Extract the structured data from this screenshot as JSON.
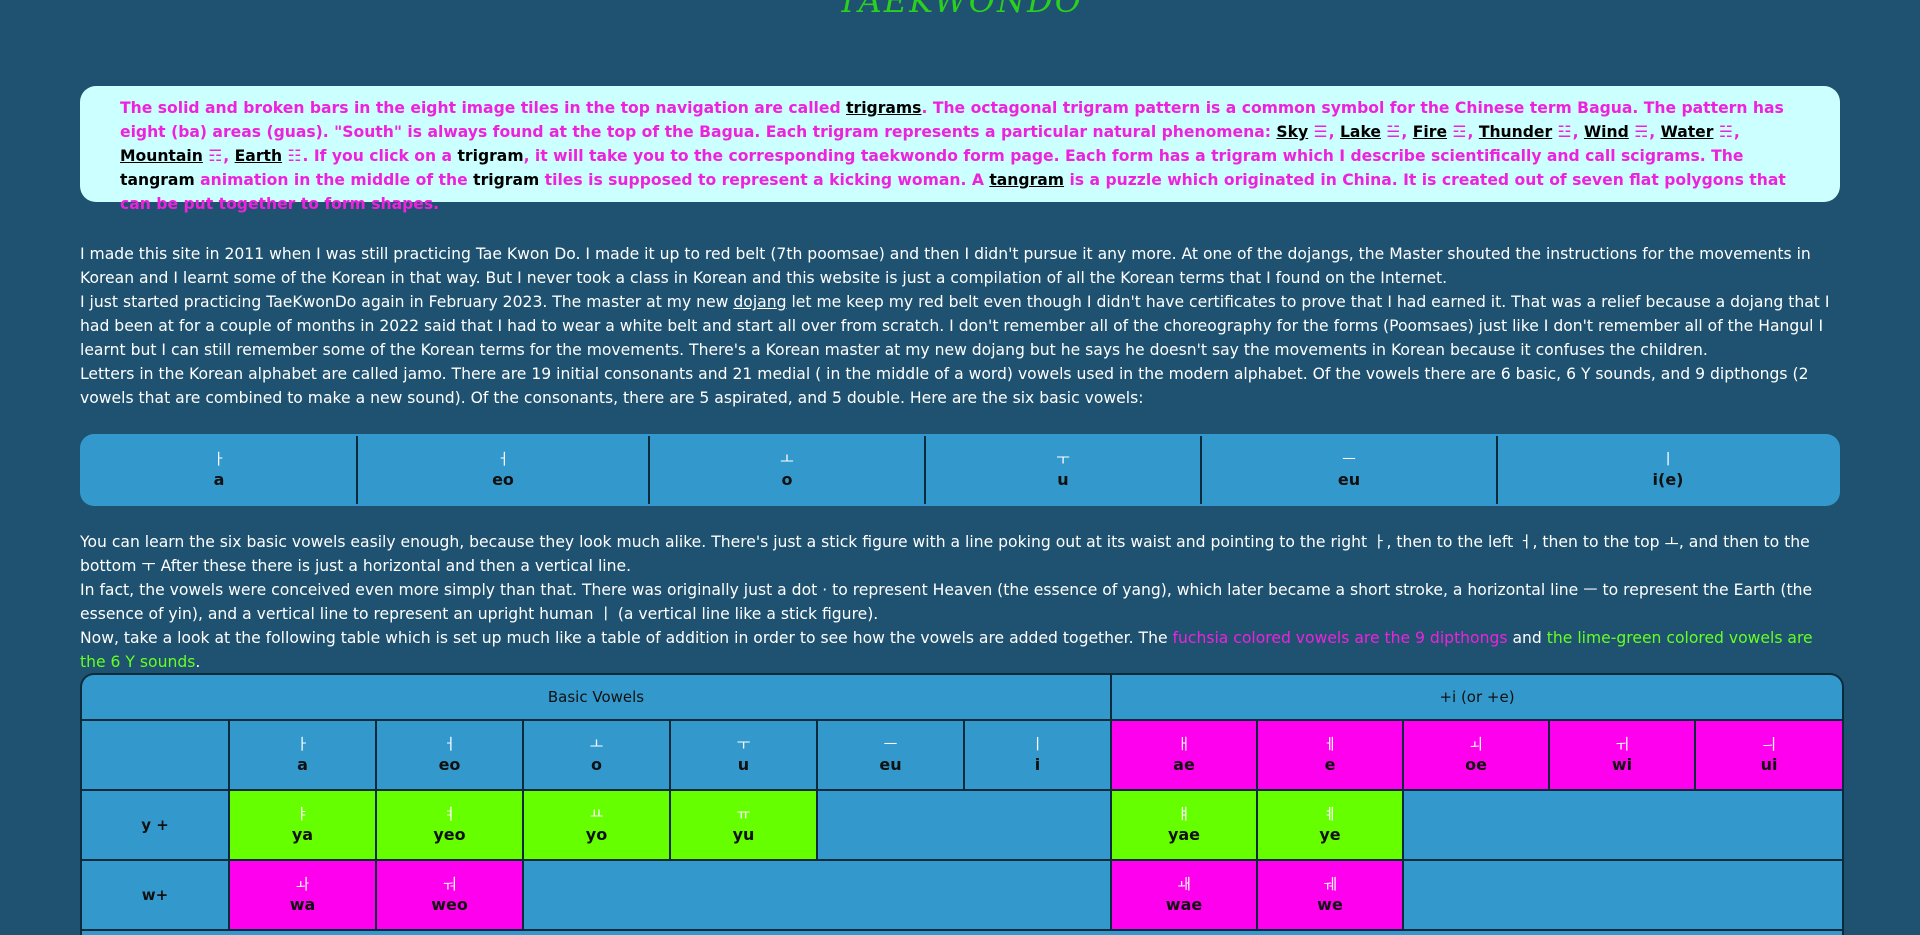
{
  "site": {
    "title": "TAEKWONDO"
  },
  "info": {
    "p1": "The solid and broken bars in the eight image tiles in the top navigation are called ",
    "trigrams_link": "trigrams",
    "p2": ". The octagonal trigram pattern is a common symbol for the Chinese term Bagua. The pattern has eight (ba) areas (guas). \"South\" is always found at the top of the Bagua. Each trigram represents a particular natural phenomena: ",
    "elements": [
      {
        "name": "Sky",
        "sym": "☰",
        "sep": ", "
      },
      {
        "name": "Lake",
        "sym": "☱",
        "sep": ", "
      },
      {
        "name": "Fire",
        "sym": "☲",
        "sep": ", "
      },
      {
        "name": "Thunder",
        "sym": "☳",
        "sep": ", "
      },
      {
        "name": "Wind",
        "sym": "☴",
        "sep": ", "
      },
      {
        "name": "Water",
        "sym": "☵",
        "sep": ", "
      },
      {
        "name": "Mountain",
        "sym": "☶",
        "sep": ", "
      },
      {
        "name": "Earth",
        "sym": "☷",
        "sep": ". "
      }
    ],
    "p3": "If you click on a ",
    "trigram_word": "trigram",
    "p4": ", it will take you to the corresponding taekwondo form page. Each form has a trigram which I describe scientifically and call scigrams. The ",
    "tangram_word": "tangram",
    "p5": " animation in the middle of the ",
    "trigram_word2": "trigram",
    "p6": " tiles is supposed to represent a kicking woman. A ",
    "tangram_link": "tangram",
    "p7": " is a puzzle which originated in China. It is created out of seven flat polygons that can be put together to form shapes."
  },
  "intro": {
    "para1": "I made this site in 2011 when I was still practicing Tae Kwon Do. I made it up to red belt (7th poomsae) and then I didn't pursue it any more. At one of the dojangs, the Master shouted the instructions for the movements in Korean and I learnt some of the Korean in that way. But I never took a class in Korean and this website is just a compilation of all the Korean terms that I found on the Internet.",
    "para2a": "I just started practicing TaeKwonDo again in February 2023. The master at my new ",
    "dojang_link": "dojang",
    "para2b": " let me keep my red belt even though I didn't have certificates to prove that I had earned it. That was a relief because a dojang that I had been at for a couple of months in 2022 said that I had to wear a white belt and start all over from scratch. I don't remember all of the choreography for the forms (Poomsaes) just like I don't remember all of the Hangul I learnt but I can still remember some of the Korean terms for the movements. There's a Korean master at my new dojang but he says he doesn't say the movements in Korean because it confuses the children.",
    "para3": "Letters in the Korean alphabet are called jamo. There are 19 initial consonants and 21 medial ( in the middle of a word) vowels used in the modern alphabet. Of the vowels there are 6 basic, 6 Y sounds, and 9 dipthongs (2 vowels that are combined to make a new sound). Of the consonants, there are 5 aspirated, and 5 double. Here are the six basic vowels:"
  },
  "basic_vowels": [
    {
      "jamo": "ㅏ",
      "rom": "a"
    },
    {
      "jamo": "ㅓ",
      "rom": "eo"
    },
    {
      "jamo": "ㅗ",
      "rom": "o"
    },
    {
      "jamo": "ㅜ",
      "rom": "u"
    },
    {
      "jamo": "ㅡ",
      "rom": "eu"
    },
    {
      "jamo": "ㅣ",
      "rom": "i(e)"
    }
  ],
  "explain": {
    "para1a": "You can learn the six basic vowels easily enough, because they look much alike. There's just a stick figure with a line poking out at its waist and pointing to the right ",
    "g_right": "ㅏ",
    "para1b": ", then to the left ",
    "g_left": "ㅓ",
    "para1c": ", then to the top ",
    "g_top": "ㅗ",
    "para1d": ", and then to the bottom ",
    "g_bottom": "ㅜ",
    "para1e": " After these there is just a horizontal and then a vertical line.",
    "para2a": "In fact, the vowels were conceived even more simply than that. There was originally just a dot ",
    "g_dot": "·",
    "para2b": " to represent Heaven (the essence of yang), which later became a short stroke, a horizontal line ",
    "g_eu": "ㅡ",
    "para2c": " to represent the Earth (the essence of yin), and a vertical line to represent an upright human ",
    "g_i": "ㅣ",
    "para2d": " (a vertical line like a stick figure).",
    "para3a": "Now, take a look at the following table which is set up much like a table of addition in order to see how the vowels are added together. The ",
    "fuchsia_text": "fuchsia colored vowels are the 9 dipthongs",
    "para3b": " and ",
    "lime_text": "the lime-green colored vowels are the 6 Y sounds",
    "para3c": "."
  },
  "grid": {
    "header_basic": "Basic Vowels",
    "header_plus_i": "+i (or +e)",
    "columns": [
      {
        "jamo": "ㅏ",
        "rom": "a",
        "color": "#3399cc"
      },
      {
        "jamo": "ㅓ",
        "rom": "eo",
        "color": "#3399cc"
      },
      {
        "jamo": "ㅗ",
        "rom": "o",
        "color": "#3399cc"
      },
      {
        "jamo": "ㅜ",
        "rom": "u",
        "color": "#3399cc"
      },
      {
        "jamo": "ㅡ",
        "rom": "eu",
        "color": "#3399cc"
      },
      {
        "jamo": "ㅣ",
        "rom": "i",
        "color": "#3399cc"
      },
      {
        "jamo": "ㅐ",
        "rom": "ae",
        "color": "#ff00ee"
      },
      {
        "jamo": "ㅔ",
        "rom": "e",
        "color": "#ff00ee"
      },
      {
        "jamo": "ㅚ",
        "rom": "oe",
        "color": "#ff00ee"
      },
      {
        "jamo": "ㅟ",
        "rom": "wi",
        "color": "#ff00ee"
      },
      {
        "jamo": "ㅢ",
        "rom": "ui",
        "color": "#ff00ee"
      }
    ],
    "row_y": {
      "label": "y +",
      "cells": [
        {
          "jamo": "ㅑ",
          "rom": "ya"
        },
        {
          "jamo": "ㅕ",
          "rom": "yeo"
        },
        {
          "jamo": "ㅛ",
          "rom": "yo"
        },
        {
          "jamo": "ㅠ",
          "rom": "yu"
        },
        {
          "jamo": "ㅒ",
          "rom": "yae"
        },
        {
          "jamo": "ㅖ",
          "rom": "ye"
        }
      ]
    },
    "row_w": {
      "label": "w+",
      "cells": [
        {
          "jamo": "ㅘ",
          "rom": "wa"
        },
        {
          "jamo": "ㅝ",
          "rom": "weo"
        },
        {
          "jamo": "ㅙ",
          "rom": "wae"
        },
        {
          "jamo": "ㅞ",
          "rom": "we"
        }
      ]
    },
    "colors": {
      "fuchsia": "#ff00ee",
      "lime": "#66ff00",
      "blue": "#3399cc"
    }
  }
}
